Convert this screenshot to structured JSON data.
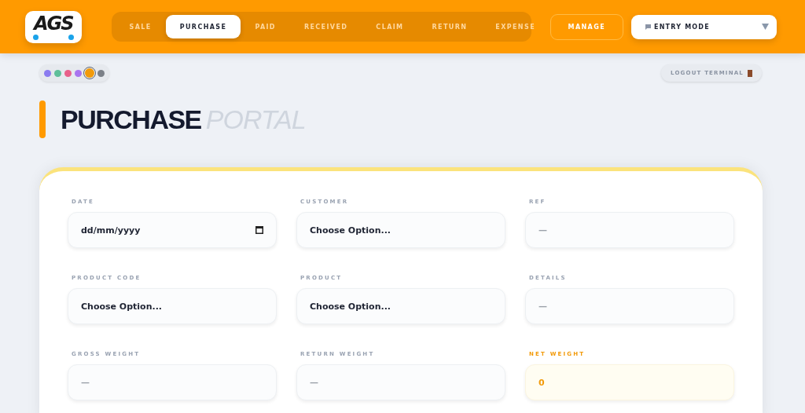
{
  "header": {
    "logo": "AGS",
    "tabs": [
      {
        "label": "SALE",
        "selected": false
      },
      {
        "label": "PURCHASE",
        "selected": true
      },
      {
        "label": "PAID",
        "selected": false
      },
      {
        "label": "RECEIVED",
        "selected": false
      },
      {
        "label": "CLAIM",
        "selected": false
      },
      {
        "label": "RETURN",
        "selected": false
      },
      {
        "label": "EXPENSE",
        "selected": false
      }
    ],
    "manage_button": "MANAGE",
    "mode_select": {
      "value": "ENTRY MODE"
    }
  },
  "swatches": [
    {
      "color": "#8b7cf0",
      "selected": false
    },
    {
      "color": "#5fbf9a",
      "selected": false
    },
    {
      "color": "#e8608a",
      "selected": false
    },
    {
      "color": "#a974ef",
      "selected": false
    },
    {
      "color": "#f29a0a",
      "selected": true
    },
    {
      "color": "#7b8088",
      "selected": false
    }
  ],
  "logout_button": "LOGOUT TERMINAL",
  "title": {
    "main": "PURCHASE",
    "sub": "PORTAL"
  },
  "fields": [
    {
      "label": "DATE",
      "kind": "date",
      "value": "dd/mm/yyyy"
    },
    {
      "label": "CUSTOMER",
      "kind": "select",
      "value": "Choose Option..."
    },
    {
      "label": "REF",
      "kind": "text",
      "placeholder": "—"
    },
    {
      "label": "PRODUCT CODE",
      "kind": "select",
      "value": "Choose Option..."
    },
    {
      "label": "PRODUCT",
      "kind": "select",
      "value": "Choose Option..."
    },
    {
      "label": "DETAILS",
      "kind": "text",
      "placeholder": "—"
    },
    {
      "label": "GROSS WEIGHT",
      "kind": "text",
      "placeholder": "—"
    },
    {
      "label": "RETURN WEIGHT",
      "kind": "text",
      "placeholder": "—"
    },
    {
      "label": "NET WEIGHT",
      "kind": "total",
      "value": "0"
    }
  ]
}
